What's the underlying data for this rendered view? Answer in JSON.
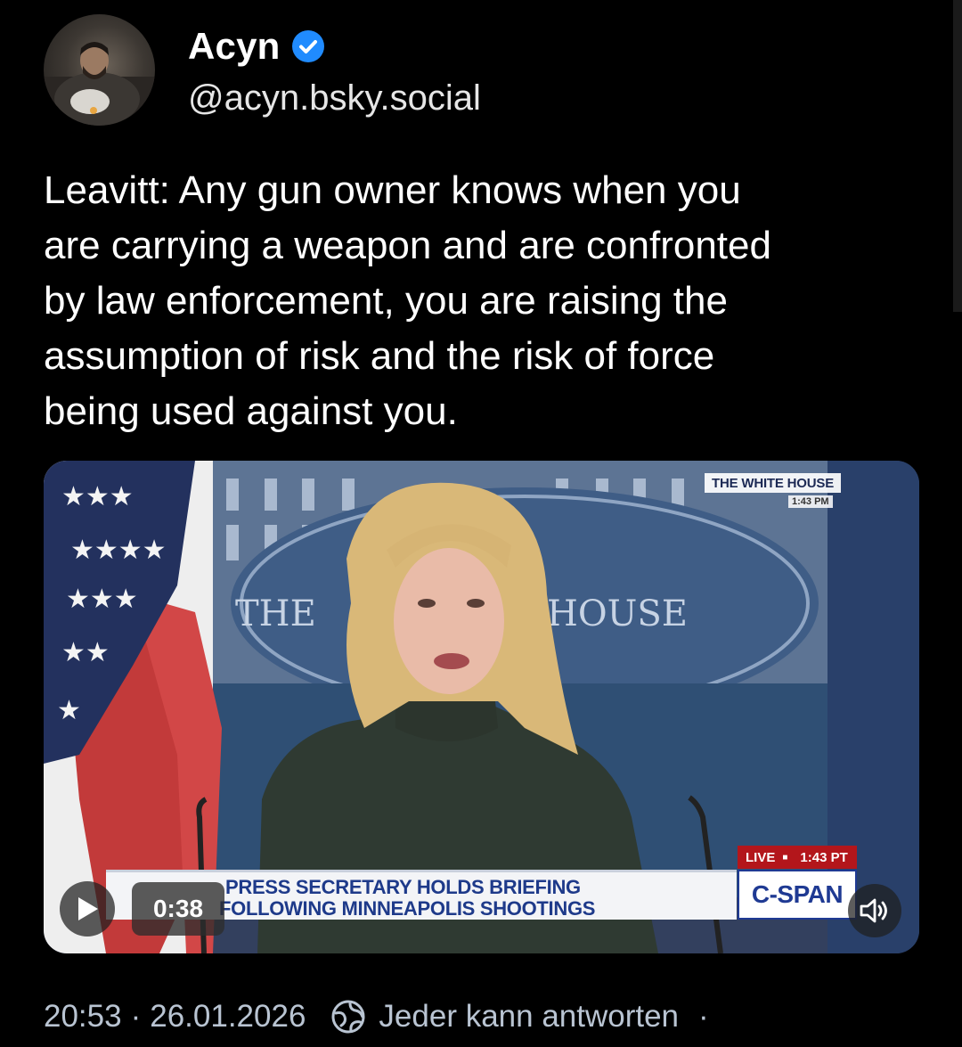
{
  "author": {
    "name": "Acyn",
    "handle": "@acyn.bsky.social",
    "verified": true,
    "verified_color": "#208bfe"
  },
  "post": {
    "text": "Leavitt: Any gun owner knows when you\nare carrying a weapon and are confronted\nby law enforcement, you are raising the\nassumption of risk and the risk of force\nbeing used against you."
  },
  "video": {
    "duration": "0:38",
    "overlay": {
      "network_badge": "THE WHITE HOUSE",
      "network_time": "1:43 PM",
      "backdrop_left": "THE",
      "backdrop_right": "HOUSE",
      "chyron_line1": "PRESS SECRETARY HOLDS BRIEFING",
      "chyron_line2": "FOLLOWING MINNEAPOLIS SHOOTINGS",
      "live_label": "LIVE",
      "live_time": "1:43 PT",
      "channel_logo": "C-SPAN"
    },
    "controls": {
      "play_icon": "play-icon",
      "mute_icon": "speaker-icon"
    }
  },
  "meta": {
    "time": "20:53",
    "date": "26.01.2026",
    "reply_icon": "globe-icon",
    "reply_setting": "Jeder kann antworten",
    "trail": "·"
  },
  "colors": {
    "background": "#000000",
    "text": "#ffffff",
    "meta_text": "#b9c4d2"
  }
}
